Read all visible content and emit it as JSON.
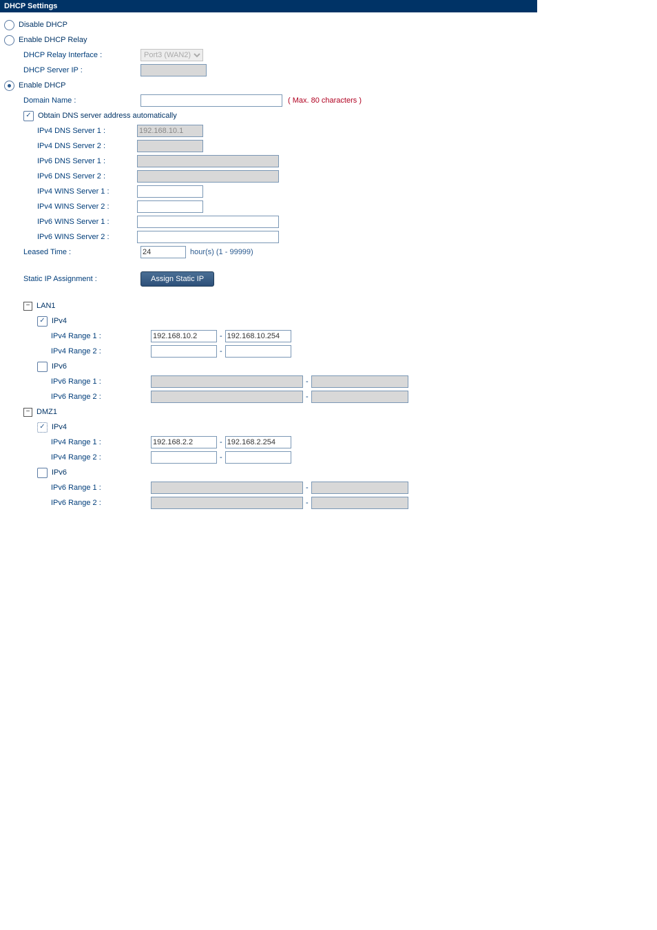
{
  "panel_title": "DHCP Settings",
  "mode": {
    "disable_label": "Disable DHCP",
    "relay_label": "Enable DHCP Relay",
    "enable_label": "Enable DHCP"
  },
  "relay": {
    "interface_label": "DHCP Relay Interface :",
    "interface_value": "Port3 (WAN2)",
    "server_ip_label": "DHCP Server IP :",
    "server_ip_value": ""
  },
  "dhcp": {
    "domain_label": "Domain Name :",
    "domain_value": "",
    "domain_hint": "( Max. 80 characters )",
    "auto_dns_label": "Obtain DNS server address automatically",
    "ipv4_dns1_label": "IPv4 DNS Server 1 :",
    "ipv4_dns1_value": "192.168.10.1",
    "ipv4_dns2_label": "IPv4 DNS Server 2 :",
    "ipv4_dns2_value": "",
    "ipv6_dns1_label": "IPv6 DNS Server 1 :",
    "ipv6_dns1_value": "",
    "ipv6_dns2_label": "IPv6 DNS Server 2 :",
    "ipv6_dns2_value": "",
    "ipv4_wins1_label": "IPv4 WINS Server 1 :",
    "ipv4_wins1_value": "",
    "ipv4_wins2_label": "IPv4 WINS Server 2 :",
    "ipv4_wins2_value": "",
    "ipv6_wins1_label": "IPv6 WINS Server 1 :",
    "ipv6_wins1_value": "",
    "ipv6_wins2_label": "IPv6 WINS Server 2 :",
    "ipv6_wins2_value": "",
    "leased_label": "Leased Time :",
    "leased_value": "24",
    "leased_hint": "hour(s) (1 - 99999)",
    "static_label": "Static IP Assignment :",
    "static_button": "Assign Static IP"
  },
  "lan1": {
    "title": "LAN1",
    "ipv4_label": "IPv4",
    "ipv6_label": "IPv6",
    "ipv4_r1_label": "IPv4 Range 1 :",
    "ipv4_r1_start": "192.168.10.2",
    "ipv4_r1_end": "192.168.10.254",
    "ipv4_r2_label": "IPv4 Range 2 :",
    "ipv4_r2_start": "",
    "ipv4_r2_end": "",
    "ipv6_r1_label": "IPv6 Range 1 :",
    "ipv6_r1_start": "",
    "ipv6_r1_end": "",
    "ipv6_r2_label": "IPv6 Range 2 :",
    "ipv6_r2_start": "",
    "ipv6_r2_end": ""
  },
  "dmz1": {
    "title": "DMZ1",
    "ipv4_label": "IPv4",
    "ipv6_label": "IPv6",
    "ipv4_r1_label": "IPv4 Range 1 :",
    "ipv4_r1_start": "192.168.2.2",
    "ipv4_r1_end": "192.168.2.254",
    "ipv4_r2_label": "IPv4 Range 2 :",
    "ipv4_r2_start": "",
    "ipv4_r2_end": "",
    "ipv6_r1_label": "IPv6 Range 1 :",
    "ipv6_r1_start": "",
    "ipv6_r1_end": "",
    "ipv6_r2_label": "IPv6 Range 2 :",
    "ipv6_r2_start": "",
    "ipv6_r2_end": ""
  }
}
